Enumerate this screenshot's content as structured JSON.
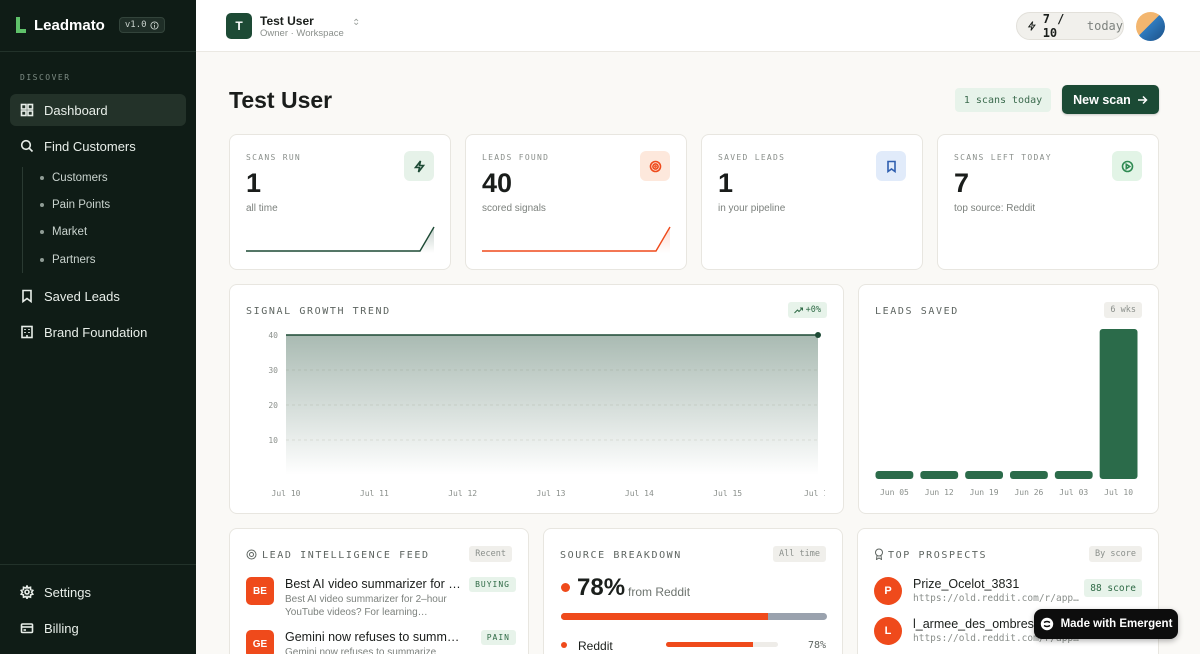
{
  "sidebar": {
    "brand": "Leadmato",
    "version": "v1.0",
    "section": "DISCOVER",
    "nav": {
      "dashboard": "Dashboard",
      "find_customers": "Find Customers",
      "sub": [
        "Customers",
        "Pain Points",
        "Market",
        "Partners"
      ],
      "saved_leads": "Saved Leads",
      "brand_foundation": "Brand Foundation",
      "settings": "Settings",
      "billing": "Billing"
    }
  },
  "topbar": {
    "workspace_initial": "T",
    "workspace_name": "Test User",
    "workspace_sub": "Owner · Workspace",
    "quota_value": "7 / 10",
    "quota_suffix": "today"
  },
  "header": {
    "title": "Test User",
    "scans_chip": "1 scans today",
    "new_scan": "New scan"
  },
  "stats": [
    {
      "label": "SCANS RUN",
      "value": "1",
      "sub": "all time",
      "icon": "bolt-icon",
      "color": "#1d4a35"
    },
    {
      "label": "LEADS FOUND",
      "value": "40",
      "sub": "scored signals",
      "icon": "target-icon",
      "color": "#ef4a1b"
    },
    {
      "label": "SAVED LEADS",
      "value": "1",
      "sub": "in your pipeline",
      "icon": "bookmark-icon",
      "color": "#2f5fb0"
    },
    {
      "label": "SCANS LEFT TODAY",
      "value": "7",
      "sub": "top source: Reddit",
      "icon": "play-icon",
      "color": "#2f8a52"
    }
  ],
  "trend": {
    "title": "SIGNAL GROWTH TREND",
    "badge": "+0%"
  },
  "leads_saved": {
    "title": "LEADS SAVED",
    "badge": "6 wks"
  },
  "feed": {
    "title": "LEAD INTELLIGENCE FEED",
    "badge": "Recent",
    "items": [
      {
        "initials": "BE",
        "title": "Best AI video summarizer for 2-hour YouTube videos?",
        "desc": "Best AI video summarizer for 2–hour YouTube videos? For learning…",
        "tag": "BUYING"
      },
      {
        "initials": "GE",
        "title": "Gemini now refuses to summarize",
        "desc": "Gemini now refuses to summarize",
        "tag": "PAIN"
      }
    ]
  },
  "source": {
    "title": "SOURCE BREAKDOWN",
    "badge": "All time",
    "percent": "78%",
    "from": "from Reddit",
    "fill": 0.78,
    "rows": [
      {
        "name": "Reddit",
        "pct": "78%",
        "fill": 0.78
      }
    ]
  },
  "prospects": {
    "title": "TOP PROSPECTS",
    "badge": "By score",
    "items": [
      {
        "initial": "P",
        "name": "Prize_Ocelot_3831",
        "url": "https://old.reddit.com/r/apps…",
        "score": "88 score"
      },
      {
        "initial": "L",
        "name": "l_armee_des_ombres",
        "url": "https://old.reddit.com/r/apps…",
        "score": ""
      }
    ]
  },
  "made_with": "Made with Emergent",
  "chart_data": [
    {
      "type": "area",
      "title": "SIGNAL GROWTH TREND",
      "x": [
        "Jul 10",
        "Jul 11",
        "Jul 12",
        "Jul 13",
        "Jul 14",
        "Jul 15",
        "Jul 1"
      ],
      "yticks": [
        40,
        30,
        20,
        10
      ],
      "ylim": [
        0,
        40
      ],
      "series": [
        {
          "values": [
            40,
            40,
            40,
            40,
            40,
            40,
            40
          ]
        }
      ],
      "grid": true,
      "color": "#1d4a35"
    },
    {
      "type": "bar",
      "title": "LEADS SAVED",
      "categories": [
        "Jun 05",
        "Jun 12",
        "Jun 19",
        "Jun 26",
        "Jul 03",
        "Jul 10"
      ],
      "values": [
        0,
        0,
        0,
        0,
        0,
        1
      ],
      "ylim": [
        0,
        1
      ],
      "color": "#2b6b4a"
    }
  ]
}
